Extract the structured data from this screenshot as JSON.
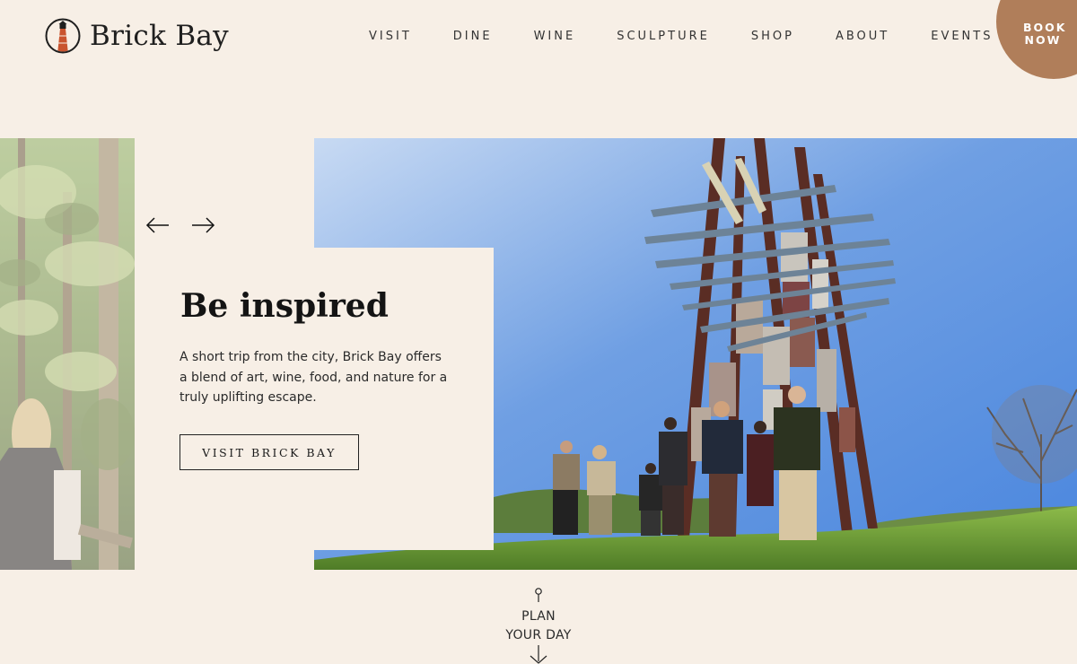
{
  "brand": {
    "name": "Brick Bay",
    "accent": "#b07e5a",
    "background": "#f7efe6"
  },
  "nav": {
    "items": [
      {
        "label": "VISIT"
      },
      {
        "label": "DINE"
      },
      {
        "label": "WINE"
      },
      {
        "label": "SCULPTURE"
      },
      {
        "label": "SHOP"
      },
      {
        "label": "ABOUT"
      },
      {
        "label": "EVENTS"
      }
    ],
    "book_line1": "BOOK",
    "book_line2": "NOW"
  },
  "hero": {
    "title": "Be inspired",
    "body": "A short trip from the city, Brick Bay offers a blend of art, wine, food, and nature for a truly uplifting escape.",
    "cta": "VISIT BRICK BAY",
    "prev_icon": "arrow-left-icon",
    "next_icon": "arrow-right-icon"
  },
  "plan": {
    "line1": "PLAN",
    "line2": "YOUR DAY",
    "icon": "pin-icon"
  }
}
